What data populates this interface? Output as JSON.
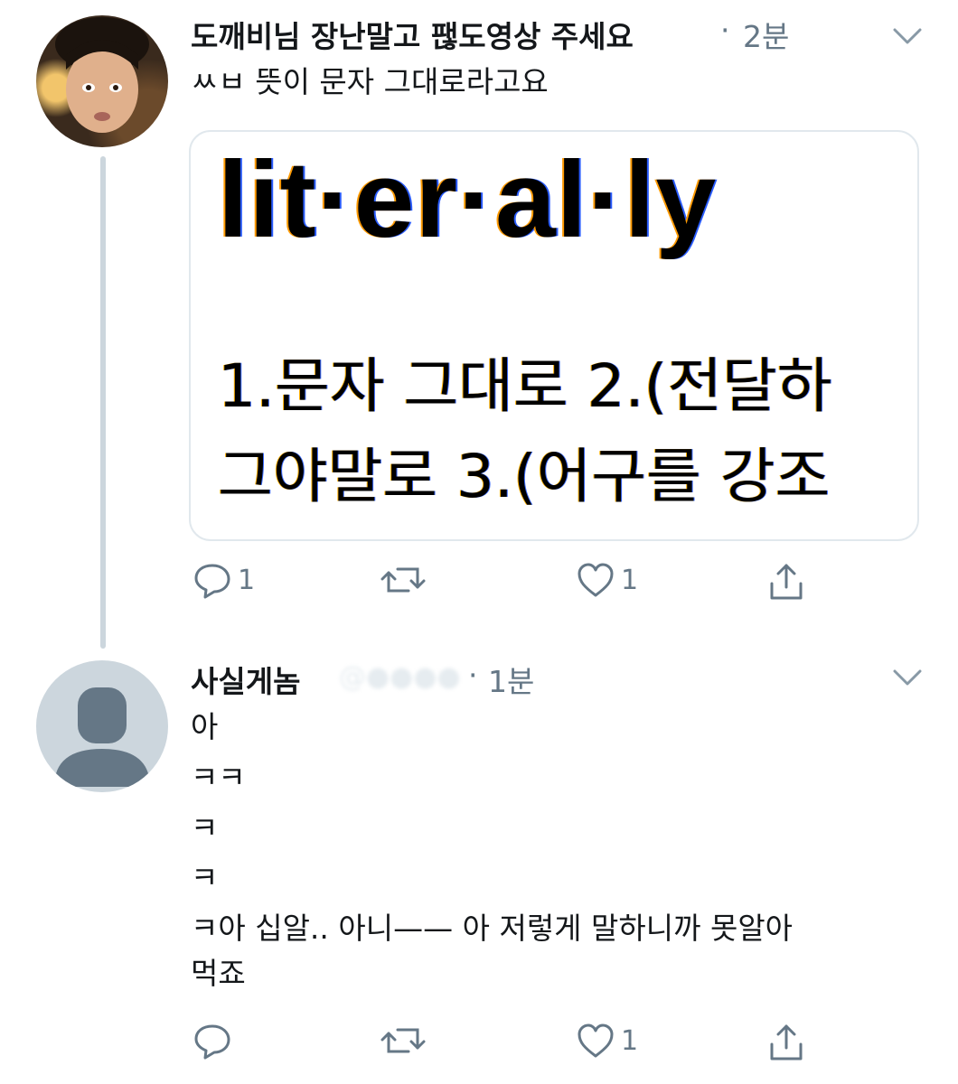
{
  "tweets": [
    {
      "name": "도깨비님 장난말고 팮도영상 주세요",
      "separator": "·",
      "time": "2분",
      "lines": [
        "ㅆㅂ 뜻이 문자 그대로라고요"
      ],
      "card": {
        "headword": "lit·er·al·ly",
        "line1": "1.문자 그대로   2.(전달하",
        "line2": "그야말로   3.(어구를 강조"
      },
      "actions": {
        "reply_count": "1",
        "retweet_count": "",
        "like_count": "1"
      }
    },
    {
      "name": "사실게놈",
      "handle": "@●●●●",
      "separator": "·",
      "time": "1분",
      "lines": [
        "아",
        "ㅋㅋ",
        "ㅋ",
        "ㅋ",
        "ㅋ아 십알.. 아니—— 아 저렇게 말하니까 못알아",
        "먹죠"
      ],
      "actions": {
        "reply_count": "",
        "retweet_count": "",
        "like_count": "1"
      }
    }
  ],
  "icons": {
    "chevron": "chevron-down-icon",
    "reply": "reply-icon",
    "retweet": "retweet-icon",
    "like": "heart-icon",
    "share": "share-icon"
  },
  "colors": {
    "text": "#14171a",
    "muted": "#657786",
    "border": "#e1e8ed",
    "thread_line": "#ccd6dd"
  }
}
